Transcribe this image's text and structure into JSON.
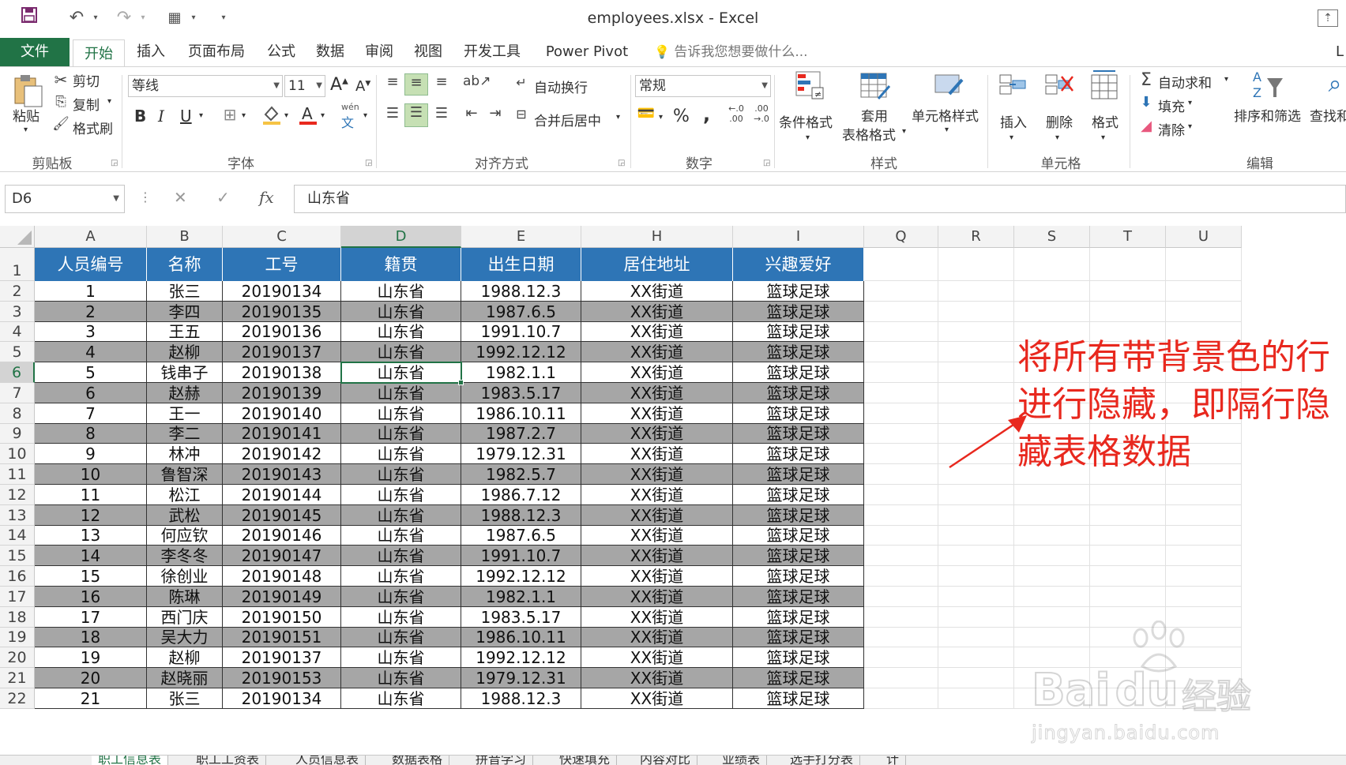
{
  "app": {
    "title": "employees.xlsx - Excel"
  },
  "quick_access": {
    "save_icon": "save-icon",
    "undo_icon": "undo-icon",
    "redo_icon": "redo-icon"
  },
  "tabs": {
    "file": "文件",
    "items": [
      "开始",
      "插入",
      "页面布局",
      "公式",
      "数据",
      "审阅",
      "视图",
      "开发工具",
      "Power Pivot"
    ],
    "tell_me": "告诉我您想要做什么...",
    "overflow": "L"
  },
  "ribbon": {
    "clipboard": {
      "paste": "粘贴",
      "cut": "剪切",
      "copy": "复制",
      "format_painter": "格式刷",
      "label": "剪贴板"
    },
    "font": {
      "font_name": "等线",
      "font_size": "11",
      "bold": "B",
      "italic": "I",
      "underline": "U",
      "grow": "A",
      "shrink": "A",
      "phonetic": "wén",
      "label": "字体"
    },
    "alignment": {
      "wrap_text": "自动换行",
      "merge_center": "合并后居中",
      "label": "对齐方式"
    },
    "number": {
      "format": "常规",
      "percent": "%",
      "comma": ",",
      "label": "数字"
    },
    "styles": {
      "conditional": "条件格式",
      "table_format_1": "套用",
      "table_format_2": "表格格式",
      "cell_styles": "单元格样式",
      "label": "样式"
    },
    "cells": {
      "insert": "插入",
      "delete": "删除",
      "format": "格式",
      "label": "单元格"
    },
    "editing": {
      "autosum": "自动求和",
      "fill": "填充",
      "clear": "清除",
      "sort_filter": "排序和筛选",
      "find_select": "查找和",
      "label": "编辑"
    }
  },
  "formula_bar": {
    "name_box": "D6",
    "cancel": "✕",
    "enter": "✓",
    "fx": "fx",
    "content": "山东省"
  },
  "grid": {
    "columns": [
      "A",
      "B",
      "C",
      "D",
      "E",
      "H",
      "I",
      "Q",
      "R",
      "S",
      "T",
      "U"
    ],
    "selected_column": "D",
    "selected_row": "6",
    "header_row": [
      "人员编号",
      "名称",
      "工号",
      "籍贯",
      "出生日期",
      "居住地址",
      "兴趣爱好"
    ],
    "rows": [
      {
        "num": "2",
        "cells": [
          "1",
          "张三",
          "20190134",
          "山东省",
          "1988.12.3",
          "XX街道",
          "篮球足球"
        ],
        "shaded": false
      },
      {
        "num": "3",
        "cells": [
          "2",
          "李四",
          "20190135",
          "山东省",
          "1987.6.5",
          "XX街道",
          "篮球足球"
        ],
        "shaded": true
      },
      {
        "num": "4",
        "cells": [
          "3",
          "王五",
          "20190136",
          "山东省",
          "1991.10.7",
          "XX街道",
          "篮球足球"
        ],
        "shaded": false
      },
      {
        "num": "5",
        "cells": [
          "4",
          "赵柳",
          "20190137",
          "山东省",
          "1992.12.12",
          "XX街道",
          "篮球足球"
        ],
        "shaded": true
      },
      {
        "num": "6",
        "cells": [
          "5",
          "钱串子",
          "20190138",
          "山东省",
          "1982.1.1",
          "XX街道",
          "篮球足球"
        ],
        "shaded": false
      },
      {
        "num": "7",
        "cells": [
          "6",
          "赵赫",
          "20190139",
          "山东省",
          "1983.5.17",
          "XX街道",
          "篮球足球"
        ],
        "shaded": true
      },
      {
        "num": "8",
        "cells": [
          "7",
          "王一",
          "20190140",
          "山东省",
          "1986.10.11",
          "XX街道",
          "篮球足球"
        ],
        "shaded": false
      },
      {
        "num": "9",
        "cells": [
          "8",
          "李二",
          "20190141",
          "山东省",
          "1987.2.7",
          "XX街道",
          "篮球足球"
        ],
        "shaded": true
      },
      {
        "num": "10",
        "cells": [
          "9",
          "林冲",
          "20190142",
          "山东省",
          "1979.12.31",
          "XX街道",
          "篮球足球"
        ],
        "shaded": false
      },
      {
        "num": "11",
        "cells": [
          "10",
          "鲁智深",
          "20190143",
          "山东省",
          "1982.5.7",
          "XX街道",
          "篮球足球"
        ],
        "shaded": true
      },
      {
        "num": "12",
        "cells": [
          "11",
          "松江",
          "20190144",
          "山东省",
          "1986.7.12",
          "XX街道",
          "篮球足球"
        ],
        "shaded": false
      },
      {
        "num": "13",
        "cells": [
          "12",
          "武松",
          "20190145",
          "山东省",
          "1988.12.3",
          "XX街道",
          "篮球足球"
        ],
        "shaded": true
      },
      {
        "num": "14",
        "cells": [
          "13",
          "何应钦",
          "20190146",
          "山东省",
          "1987.6.5",
          "XX街道",
          "篮球足球"
        ],
        "shaded": false
      },
      {
        "num": "15",
        "cells": [
          "14",
          "李冬冬",
          "20190147",
          "山东省",
          "1991.10.7",
          "XX街道",
          "篮球足球"
        ],
        "shaded": true
      },
      {
        "num": "16",
        "cells": [
          "15",
          "徐创业",
          "20190148",
          "山东省",
          "1992.12.12",
          "XX街道",
          "篮球足球"
        ],
        "shaded": false
      },
      {
        "num": "17",
        "cells": [
          "16",
          "陈琳",
          "20190149",
          "山东省",
          "1982.1.1",
          "XX街道",
          "篮球足球"
        ],
        "shaded": true
      },
      {
        "num": "18",
        "cells": [
          "17",
          "西门庆",
          "20190150",
          "山东省",
          "1983.5.17",
          "XX街道",
          "篮球足球"
        ],
        "shaded": false
      },
      {
        "num": "19",
        "cells": [
          "18",
          "吴大力",
          "20190151",
          "山东省",
          "1986.10.11",
          "XX街道",
          "篮球足球"
        ],
        "shaded": true
      },
      {
        "num": "20",
        "cells": [
          "19",
          "赵柳",
          "20190137",
          "山东省",
          "1992.12.12",
          "XX街道",
          "篮球足球"
        ],
        "shaded": false
      },
      {
        "num": "21",
        "cells": [
          "20",
          "赵晓丽",
          "20190153",
          "山东省",
          "1979.12.31",
          "XX街道",
          "篮球足球"
        ],
        "shaded": true
      },
      {
        "num": "22",
        "cells": [
          "21",
          "张三",
          "20190134",
          "山东省",
          "1988.12.3",
          "XX街道",
          "篮球足球"
        ],
        "shaded": false
      }
    ]
  },
  "annotation": {
    "lines": [
      "将所有带背景色的行",
      "进行隐藏，即隔行隐",
      "藏表格数据"
    ],
    "color": "#e8281e"
  },
  "watermark": {
    "brand": "Bai",
    "brand2": "du",
    "cn": "经验",
    "url": "jingyan.baidu.com"
  },
  "sheet_tabs": [
    "职工信息表",
    "职工工资表",
    "人员信息表",
    "数据表格",
    "拼音学习",
    "快速填充",
    "内容对比",
    "业绩表",
    "选手打分表",
    "计"
  ],
  "colors": {
    "excel_green": "#217346",
    "header_blue": "#2e75b6",
    "row_gray": "#a6a6a6"
  }
}
